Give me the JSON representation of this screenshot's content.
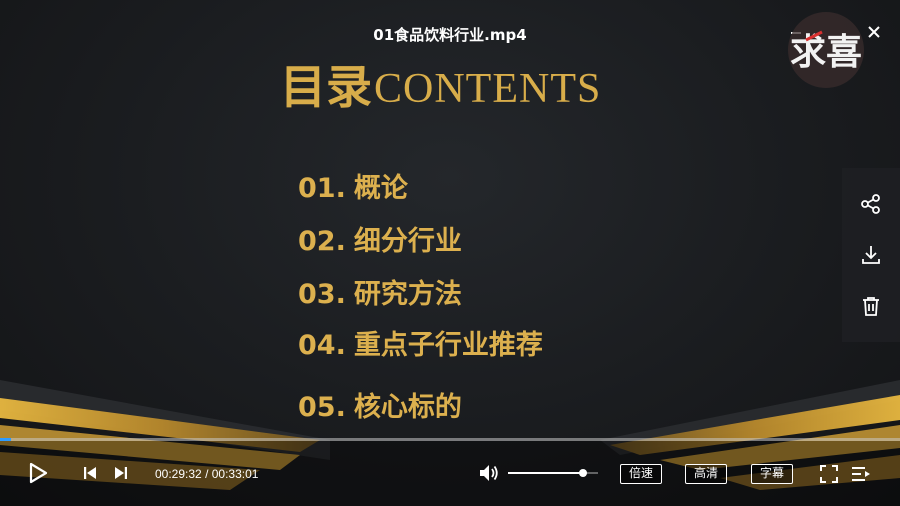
{
  "video": {
    "title": "01食品饮料行业.mp4",
    "watermark_text": "求喜"
  },
  "slide": {
    "heading_zh": "目录",
    "heading_en": "CONTENTS",
    "items": [
      {
        "num": "01.",
        "label": "概论"
      },
      {
        "num": "02.",
        "label": "细分行业"
      },
      {
        "num": "03.",
        "label": "研究方法"
      },
      {
        "num": "04.",
        "label": "重点子行业推荐"
      },
      {
        "num": "05.",
        "label": "核心标的"
      }
    ],
    "accent_color": "#dcb04e"
  },
  "window": {
    "minimize_icon": "minimize-icon",
    "close_icon": "close-icon"
  },
  "side_tools": [
    "share-icon",
    "download-icon",
    "trash-icon"
  ],
  "playback": {
    "current_time": "00:29:32",
    "separator": "/",
    "total_time": "00:33:01",
    "progress_fraction": 0.012,
    "volume_fraction": 0.83
  },
  "controls": {
    "speed_label": "倍速",
    "quality_label": "高清",
    "subtitle_label": "字幕"
  },
  "colors": {
    "progress_played": "#2e9cff",
    "gold": "#d8ad4a"
  }
}
